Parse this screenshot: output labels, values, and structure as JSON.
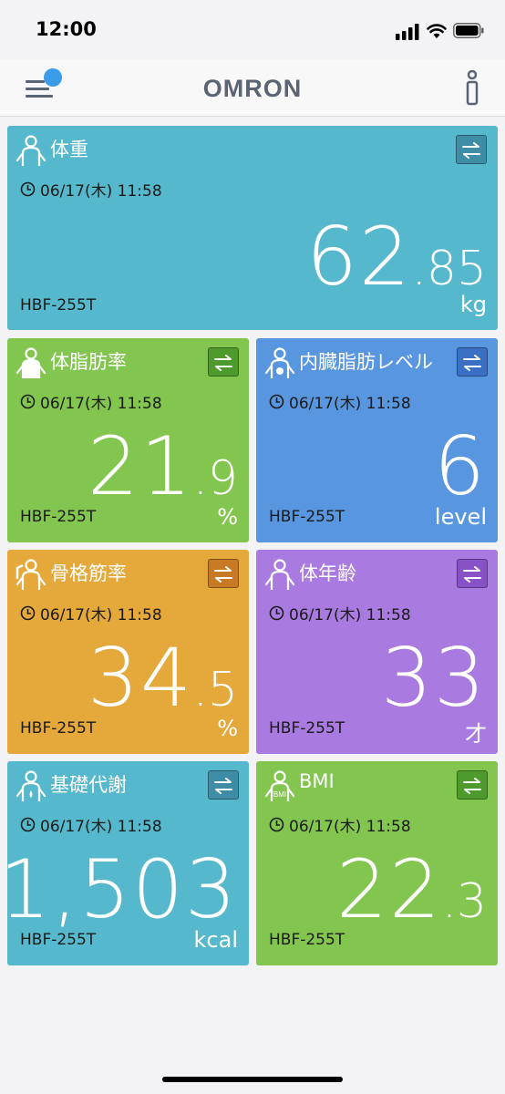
{
  "status": {
    "time": "12:00"
  },
  "nav": {
    "brand": "OMRON"
  },
  "cards": [
    {
      "title": "体重",
      "time": "06/17(木) 11:58",
      "int": "62",
      "dot": ".",
      "dec": "85",
      "unit": "kg",
      "device": "HBF-255T",
      "color": "#56b8cc",
      "btn_color": "#3f8ca6"
    },
    {
      "title": "体脂肪率",
      "time": "06/17(木) 11:58",
      "int": "21",
      "dot": ".",
      "dec": "9",
      "unit": "%",
      "device": "HBF-255T",
      "color": "#82c54f",
      "btn_color": "#4f9a2c"
    },
    {
      "title": "内臓脂肪レベル",
      "time": "06/17(木) 11:58",
      "int": "6",
      "dot": "",
      "dec": "",
      "unit": "level",
      "device": "HBF-255T",
      "color": "#5896e0",
      "btn_color": "#3a6fc4"
    },
    {
      "title": "骨格筋率",
      "time": "06/17(木) 11:58",
      "int": "34",
      "dot": ".",
      "dec": "5",
      "unit": "%",
      "device": "HBF-255T",
      "color": "#e5a83a",
      "btn_color": "#c77a23"
    },
    {
      "title": "体年齢",
      "time": "06/17(木) 11:58",
      "int": "33",
      "dot": "",
      "dec": "",
      "unit": "才",
      "device": "HBF-255T",
      "color": "#a97ae0",
      "btn_color": "#8752c6"
    },
    {
      "title": "基礎代謝",
      "time": "06/17(木) 11:58",
      "int": "1,503",
      "dot": "",
      "dec": "",
      "unit": "kcal",
      "device": "HBF-255T",
      "color": "#56b8cc",
      "btn_color": "#3f8ca6"
    },
    {
      "title": "BMI",
      "time": "06/17(木) 11:58",
      "int": "22",
      "dot": ".",
      "dec": "3",
      "unit": "",
      "device": "HBF-255T",
      "color": "#82c54f",
      "btn_color": "#4f9a2c"
    }
  ]
}
